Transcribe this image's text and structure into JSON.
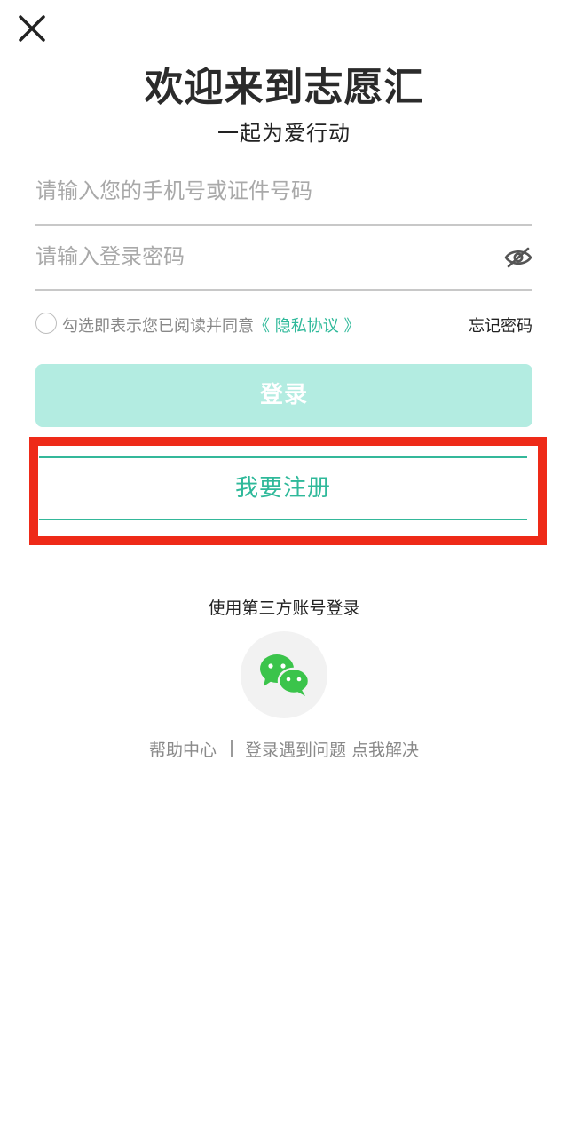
{
  "header": {
    "close_icon": "close-icon",
    "title": "欢迎来到志愿汇",
    "subtitle": "一起为爱行动"
  },
  "form": {
    "phone_placeholder": "请输入您的手机号或证件号码",
    "password_placeholder": "请输入登录密码",
    "password_toggle_icon": "eye-off-icon",
    "agree_text": "勾选即表示您已阅读并同意",
    "privacy_link": "《 隐私协议 》",
    "forgot_password": "忘记密码",
    "login_label": "登录",
    "register_label": "我要注册"
  },
  "third_party": {
    "label": "使用第三方账号登录",
    "wechat_icon": "wechat-icon"
  },
  "footer": {
    "help_center": "帮助中心",
    "problem_link": "登录遇到问题 点我解决"
  },
  "colors": {
    "accent": "#2fb99a",
    "login_button_bg": "#b3ece1",
    "highlight_border": "#ee2a18",
    "wechat_green": "#3bc44b"
  }
}
